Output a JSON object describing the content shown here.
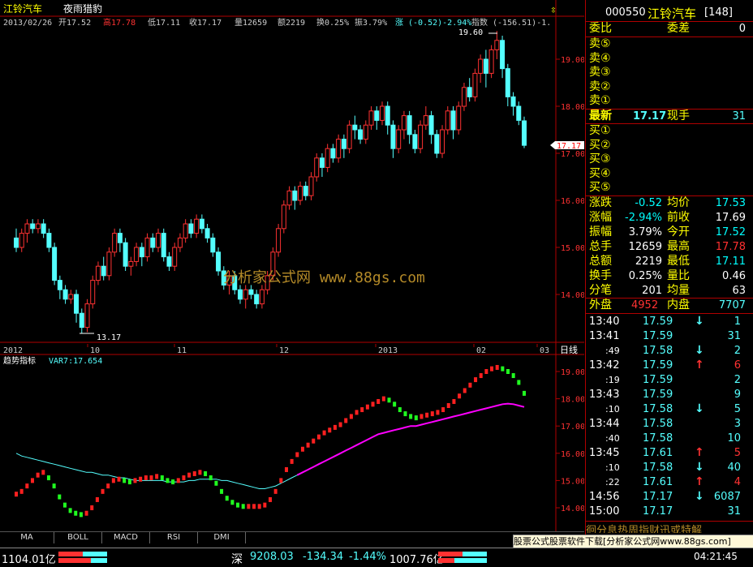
{
  "header": {
    "stock_name": "江铃汽车",
    "indicator_name": "夜雨猎豹",
    "alert_icon": "bell-icon",
    "info_line": {
      "date": "2013/02/26",
      "open": "开17.52",
      "high": "高17.78",
      "low": "低17.11",
      "close": "收17.17",
      "volume": "量12659",
      "amount": "额2219",
      "turnover": "换0.25%",
      "amplitude": "振3.79%",
      "change": "涨 (-0.52)-2.94%",
      "index": "指数 (-156.51)-1."
    }
  },
  "price_chart": {
    "y_ticks": [
      "19.00",
      "18.00",
      "17.00",
      "16.00",
      "15.00",
      "14.00"
    ],
    "current_price_label": "17.17",
    "high_label": "19.60",
    "low_label": "13.17",
    "x_labels": [
      "2012",
      "10",
      "11",
      "12",
      "2013",
      "02",
      "03"
    ],
    "period_label": "日线",
    "watermark": "分析家公式网 www.88gs.com"
  },
  "indicator_chart": {
    "title": "趋势指标",
    "value_label": "VAR7:17.654",
    "y_ticks": [
      "19.00",
      "18.00",
      "17.00",
      "16.00",
      "15.00",
      "14.00"
    ]
  },
  "tabs": [
    "MA",
    "BOLL",
    "MACD",
    "RSI",
    "DMI"
  ],
  "panel": {
    "code": "000550",
    "name": "江铃汽车",
    "count": "[148]",
    "weibi_label": "委比",
    "weicha_label": "委差",
    "weicha_value": "0",
    "sell_levels": [
      "卖⑤",
      "卖④",
      "卖③",
      "卖②",
      "卖①"
    ],
    "latest_label": "最新",
    "latest_value": "17.17",
    "xianshou_label": "现手",
    "xianshou_value": "31",
    "buy_levels": [
      "买①",
      "买②",
      "买③",
      "买④",
      "买⑤"
    ],
    "stats": [
      {
        "l1": "涨跌",
        "v1": "-0.52",
        "l2": "均价",
        "v2": "17.53",
        "c1": "#00ffff",
        "c2": "#00ffff"
      },
      {
        "l1": "涨幅",
        "v1": "-2.94%",
        "l2": "前收",
        "v2": "17.69",
        "c1": "#00ffff",
        "c2": "#ffffff"
      },
      {
        "l1": "振幅",
        "v1": "3.79%",
        "l2": "今开",
        "v2": "17.52",
        "c1": "#ffffff",
        "c2": "#00ffff"
      },
      {
        "l1": "总手",
        "v1": "12659",
        "l2": "最高",
        "v2": "17.78",
        "c1": "#ffffff",
        "c2": "#ff3030"
      },
      {
        "l1": "总额",
        "v1": "2219",
        "l2": "最低",
        "v2": "17.11",
        "c1": "#ffffff",
        "c2": "#00ffff"
      },
      {
        "l1": "换手",
        "v1": "0.25%",
        "l2": "量比",
        "v2": "0.46",
        "c1": "#ffffff",
        "c2": "#ffffff"
      },
      {
        "l1": "分笔",
        "v1": "201",
        "l2": "均量",
        "v2": "63",
        "c1": "#ffffff",
        "c2": "#ffffff"
      }
    ],
    "waipan_label": "外盘",
    "waipan_value": "4952",
    "neipan_label": "内盘",
    "neipan_value": "7707",
    "ticks": [
      {
        "time": "13:40",
        "price": "17.59",
        "dir": "down",
        "vol": "1"
      },
      {
        "time": "13:41",
        "price": "17.59",
        "dir": "",
        "vol": "31"
      },
      {
        "time": ":49",
        "price": "17.58",
        "dir": "down",
        "vol": "2"
      },
      {
        "time": "13:42",
        "price": "17.59",
        "dir": "up",
        "vol": "6"
      },
      {
        "time": ":19",
        "price": "17.59",
        "dir": "",
        "vol": "2"
      },
      {
        "time": "13:43",
        "price": "17.59",
        "dir": "",
        "vol": "9"
      },
      {
        "time": ":10",
        "price": "17.58",
        "dir": "down",
        "vol": "5"
      },
      {
        "time": "13:44",
        "price": "17.58",
        "dir": "",
        "vol": "3"
      },
      {
        "time": ":40",
        "price": "17.58",
        "dir": "",
        "vol": "10"
      },
      {
        "time": "13:45",
        "price": "17.61",
        "dir": "up",
        "vol": "5"
      },
      {
        "time": ":10",
        "price": "17.58",
        "dir": "down",
        "vol": "40"
      },
      {
        "time": ":22",
        "price": "17.61",
        "dir": "up",
        "vol": "4"
      },
      {
        "time": "14:56",
        "price": "17.17",
        "dir": "down",
        "vol": "6087"
      },
      {
        "time": "15:00",
        "price": "17.17",
        "dir": "",
        "vol": "31"
      }
    ],
    "ad_text": "股票公式股票软件下载[分析家公式网www.88gs.com]"
  },
  "bottom": {
    "left_value": "1104.01亿",
    "index_name": "深",
    "index_value": "9208.03",
    "index_change": "-134.34",
    "index_pct": "-1.44%",
    "index_amount": "1007.76亿",
    "time": "04:21:45"
  },
  "colors": {
    "up": "#ff3232",
    "down": "#54ffff",
    "ma": "#ff00ff",
    "up_ind": "#ff2020",
    "down_ind": "#20ff20",
    "axis": "#b00000"
  },
  "chart_data": {
    "type": "candlestick",
    "y_range": [
      13.0,
      19.8
    ],
    "candles": [
      [
        15.2,
        15.0,
        15.4,
        14.9
      ],
      [
        15.0,
        15.3,
        15.4,
        14.9
      ],
      [
        15.3,
        15.5,
        15.6,
        15.1
      ],
      [
        15.5,
        15.4,
        15.6,
        15.3
      ],
      [
        15.4,
        15.5,
        15.6,
        15.3
      ],
      [
        15.5,
        15.3,
        15.6,
        15.2
      ],
      [
        15.3,
        15.0,
        15.4,
        14.9
      ],
      [
        15.0,
        14.3,
        15.1,
        14.2
      ],
      [
        14.3,
        14.1,
        14.4,
        13.9
      ],
      [
        14.1,
        13.9,
        14.2,
        13.8
      ],
      [
        13.9,
        14.0,
        14.1,
        13.8
      ],
      [
        14.0,
        13.6,
        14.1,
        13.4
      ],
      [
        13.6,
        13.3,
        13.7,
        13.17
      ],
      [
        13.3,
        13.8,
        13.9,
        13.2
      ],
      [
        13.8,
        14.3,
        14.4,
        13.7
      ],
      [
        14.3,
        14.6,
        14.7,
        14.2
      ],
      [
        14.6,
        14.4,
        14.8,
        14.3
      ],
      [
        14.4,
        14.9,
        15.0,
        14.3
      ],
      [
        14.9,
        15.3,
        15.4,
        14.8
      ],
      [
        15.3,
        15.1,
        15.4,
        14.9
      ],
      [
        15.1,
        14.6,
        15.2,
        14.5
      ],
      [
        14.6,
        14.7,
        14.8,
        14.4
      ],
      [
        14.7,
        15.0,
        15.1,
        14.6
      ],
      [
        15.0,
        14.8,
        15.1,
        14.6
      ],
      [
        14.8,
        15.2,
        15.3,
        14.7
      ],
      [
        15.2,
        15.0,
        15.3,
        14.9
      ],
      [
        15.0,
        15.3,
        15.4,
        14.9
      ],
      [
        15.3,
        14.8,
        15.4,
        14.7
      ],
      [
        14.8,
        14.6,
        14.9,
        14.5
      ],
      [
        14.6,
        15.0,
        15.1,
        14.5
      ],
      [
        15.0,
        15.2,
        15.3,
        14.9
      ],
      [
        15.2,
        15.5,
        15.6,
        15.1
      ],
      [
        15.5,
        15.3,
        15.6,
        15.2
      ],
      [
        15.3,
        15.6,
        15.7,
        15.2
      ],
      [
        15.6,
        15.4,
        15.7,
        15.3
      ],
      [
        15.4,
        15.2,
        15.5,
        15.1
      ],
      [
        15.2,
        14.9,
        15.3,
        14.8
      ],
      [
        14.9,
        14.5,
        15.0,
        14.4
      ],
      [
        14.5,
        14.2,
        14.6,
        14.1
      ],
      [
        14.2,
        14.4,
        14.5,
        14.0
      ],
      [
        14.4,
        14.1,
        14.5,
        14.0
      ],
      [
        14.1,
        13.9,
        14.2,
        13.8
      ],
      [
        13.9,
        14.1,
        14.2,
        13.7
      ],
      [
        14.1,
        14.0,
        14.2,
        13.9
      ],
      [
        14.0,
        13.8,
        14.1,
        13.7
      ],
      [
        13.8,
        14.1,
        14.2,
        13.7
      ],
      [
        14.1,
        14.4,
        14.5,
        14.0
      ],
      [
        14.4,
        14.9,
        15.0,
        14.3
      ],
      [
        14.9,
        15.4,
        15.5,
        14.8
      ],
      [
        15.4,
        15.9,
        16.0,
        15.3
      ],
      [
        15.9,
        16.2,
        16.3,
        15.8
      ],
      [
        16.2,
        16.0,
        16.3,
        15.8
      ],
      [
        16.0,
        16.3,
        16.4,
        15.9
      ],
      [
        16.3,
        16.1,
        16.4,
        16.0
      ],
      [
        16.1,
        16.5,
        16.6,
        16.0
      ],
      [
        16.5,
        16.9,
        17.0,
        16.4
      ],
      [
        16.9,
        16.7,
        17.0,
        16.5
      ],
      [
        16.7,
        17.1,
        17.2,
        16.6
      ],
      [
        17.1,
        16.9,
        17.2,
        16.8
      ],
      [
        16.9,
        17.3,
        17.4,
        16.8
      ],
      [
        17.3,
        17.1,
        17.4,
        16.9
      ],
      [
        17.1,
        17.6,
        17.7,
        17.0
      ],
      [
        17.6,
        17.5,
        17.8,
        17.3
      ],
      [
        17.5,
        17.3,
        17.6,
        17.2
      ],
      [
        17.3,
        17.6,
        17.7,
        17.2
      ],
      [
        17.6,
        17.9,
        18.0,
        17.5
      ],
      [
        17.9,
        17.7,
        18.0,
        17.5
      ],
      [
        17.7,
        18.0,
        18.1,
        17.6
      ],
      [
        18.0,
        17.6,
        18.1,
        17.4
      ],
      [
        17.6,
        17.1,
        17.7,
        16.9
      ],
      [
        17.1,
        17.5,
        17.6,
        17.0
      ],
      [
        17.5,
        17.8,
        17.9,
        17.3
      ],
      [
        17.8,
        17.4,
        17.9,
        17.2
      ],
      [
        17.4,
        17.1,
        17.5,
        17.0
      ],
      [
        17.1,
        17.6,
        17.7,
        17.0
      ],
      [
        17.6,
        17.8,
        18.0,
        17.5
      ],
      [
        17.8,
        17.4,
        17.9,
        17.2
      ],
      [
        17.4,
        17.0,
        17.5,
        16.9
      ],
      [
        17.0,
        17.5,
        17.6,
        16.9
      ],
      [
        17.5,
        17.9,
        18.0,
        17.4
      ],
      [
        17.9,
        17.5,
        18.0,
        17.3
      ],
      [
        17.5,
        18.0,
        18.1,
        17.4
      ],
      [
        18.0,
        18.4,
        18.5,
        17.9
      ],
      [
        18.4,
        18.2,
        18.6,
        18.1
      ],
      [
        18.2,
        18.7,
        18.8,
        18.1
      ],
      [
        18.7,
        19.0,
        19.1,
        18.5
      ],
      [
        19.0,
        18.7,
        19.2,
        18.4
      ],
      [
        18.7,
        19.2,
        19.3,
        18.6
      ],
      [
        19.2,
        19.4,
        19.6,
        19.0
      ],
      [
        19.4,
        18.8,
        19.5,
        18.6
      ],
      [
        18.8,
        18.2,
        18.9,
        18.0
      ],
      [
        18.2,
        18.0,
        18.3,
        17.8
      ],
      [
        18.0,
        17.7,
        18.1,
        17.6
      ],
      [
        17.69,
        17.17,
        17.78,
        17.11
      ]
    ],
    "indicator": [
      14.5,
      14.6,
      14.8,
      15.0,
      15.2,
      15.3,
      15.1,
      14.8,
      14.4,
      14.1,
      13.9,
      13.8,
      13.75,
      13.8,
      14.0,
      14.3,
      14.6,
      14.8,
      15.0,
      15.05,
      15.0,
      14.95,
      15.0,
      15.05,
      15.1,
      15.1,
      15.15,
      15.1,
      15.0,
      14.95,
      15.0,
      15.1,
      15.2,
      15.25,
      15.3,
      15.25,
      15.1,
      14.9,
      14.6,
      14.35,
      14.2,
      14.1,
      14.05,
      14.05,
      14.05,
      14.05,
      14.1,
      14.3,
      14.6,
      15.0,
      15.4,
      15.7,
      15.95,
      16.15,
      16.3,
      16.45,
      16.6,
      16.75,
      16.85,
      16.95,
      17.05,
      17.2,
      17.35,
      17.5,
      17.6,
      17.7,
      17.8,
      17.9,
      18.0,
      17.95,
      17.8,
      17.6,
      17.45,
      17.35,
      17.3,
      17.35,
      17.4,
      17.45,
      17.5,
      17.6,
      17.75,
      17.9,
      18.1,
      18.3,
      18.5,
      18.7,
      18.85,
      19.0,
      19.1,
      19.15,
      19.1,
      19.0,
      18.85,
      18.6,
      18.2
    ],
    "ma_line": [
      16.0,
      15.9,
      15.85,
      15.8,
      15.75,
      15.7,
      15.65,
      15.6,
      15.55,
      15.5,
      15.45,
      15.4,
      15.35,
      15.3,
      15.3,
      15.25,
      15.2,
      15.2,
      15.15,
      15.1,
      15.1,
      15.05,
      15.0,
      15.0,
      15.0,
      15.0,
      15.0,
      15.0,
      14.95,
      14.95,
      14.95,
      14.95,
      15.0,
      15.0,
      15.05,
      15.05,
      15.05,
      15.05,
      15.0,
      15.0,
      14.95,
      14.9,
      14.85,
      14.8,
      14.75,
      14.7,
      14.7,
      14.75,
      14.8,
      14.9,
      15.0,
      15.1,
      15.2,
      15.3,
      15.4,
      15.5,
      15.6,
      15.7,
      15.8,
      15.9,
      16.0,
      16.1,
      16.2,
      16.3,
      16.4,
      16.5,
      16.6,
      16.7,
      16.75,
      16.8,
      16.85,
      16.9,
      16.95,
      17.0,
      17.0,
      17.05,
      17.1,
      17.15,
      17.2,
      17.25,
      17.3,
      17.35,
      17.4,
      17.45,
      17.5,
      17.55,
      17.6,
      17.65,
      17.7,
      17.75,
      17.8,
      17.82,
      17.8,
      17.75,
      17.7
    ]
  }
}
